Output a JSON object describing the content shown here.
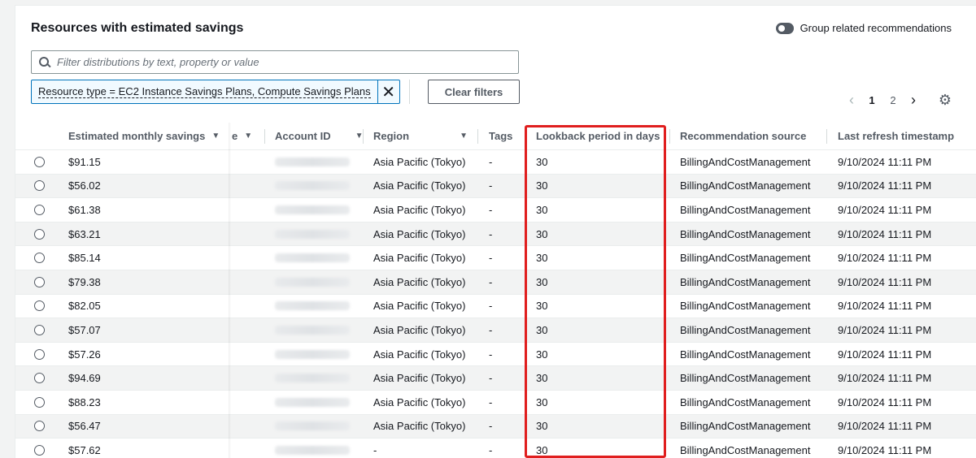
{
  "panel": {
    "title": "Resources with estimated savings",
    "group_toggle_label": "Group related recommendations"
  },
  "search": {
    "placeholder": "Filter distributions by text, property or value",
    "value": ""
  },
  "filter_token": {
    "text": "Resource type = EC2 Instance Savings Plans, Compute Savings Plans"
  },
  "clear_filters_label": "Clear filters",
  "pagination": {
    "prev": "‹",
    "pages": [
      "1",
      "2"
    ],
    "next": "›",
    "current": "1"
  },
  "icons": {
    "search": "search-icon",
    "close": "close-icon",
    "settings": "gear-icon",
    "sort": "caret-down-icon"
  },
  "colors": {
    "highlight": "#e01e1e",
    "link_blue": "#0073bb",
    "header_text": "#545b64"
  },
  "table": {
    "headers": {
      "savings": "Estimated monthly savings",
      "truncated": "e",
      "account": "Account ID",
      "region": "Region",
      "tags": "Tags",
      "lookback": "Lookback period in days",
      "source": "Recommendation source",
      "refresh": "Last refresh timestamp"
    },
    "rows": [
      {
        "savings": "$91.15",
        "region": "Asia Pacific (Tokyo)",
        "tags": "-",
        "lookback": "30",
        "source": "BillingAndCostManagement",
        "refresh": "9/10/2024 11:11 PM"
      },
      {
        "savings": "$56.02",
        "region": "Asia Pacific (Tokyo)",
        "tags": "-",
        "lookback": "30",
        "source": "BillingAndCostManagement",
        "refresh": "9/10/2024 11:11 PM"
      },
      {
        "savings": "$61.38",
        "region": "Asia Pacific (Tokyo)",
        "tags": "-",
        "lookback": "30",
        "source": "BillingAndCostManagement",
        "refresh": "9/10/2024 11:11 PM"
      },
      {
        "savings": "$63.21",
        "region": "Asia Pacific (Tokyo)",
        "tags": "-",
        "lookback": "30",
        "source": "BillingAndCostManagement",
        "refresh": "9/10/2024 11:11 PM"
      },
      {
        "savings": "$85.14",
        "region": "Asia Pacific (Tokyo)",
        "tags": "-",
        "lookback": "30",
        "source": "BillingAndCostManagement",
        "refresh": "9/10/2024 11:11 PM"
      },
      {
        "savings": "$79.38",
        "region": "Asia Pacific (Tokyo)",
        "tags": "-",
        "lookback": "30",
        "source": "BillingAndCostManagement",
        "refresh": "9/10/2024 11:11 PM"
      },
      {
        "savings": "$82.05",
        "region": "Asia Pacific (Tokyo)",
        "tags": "-",
        "lookback": "30",
        "source": "BillingAndCostManagement",
        "refresh": "9/10/2024 11:11 PM"
      },
      {
        "savings": "$57.07",
        "region": "Asia Pacific (Tokyo)",
        "tags": "-",
        "lookback": "30",
        "source": "BillingAndCostManagement",
        "refresh": "9/10/2024 11:11 PM"
      },
      {
        "savings": "$57.26",
        "region": "Asia Pacific (Tokyo)",
        "tags": "-",
        "lookback": "30",
        "source": "BillingAndCostManagement",
        "refresh": "9/10/2024 11:11 PM"
      },
      {
        "savings": "$94.69",
        "region": "Asia Pacific (Tokyo)",
        "tags": "-",
        "lookback": "30",
        "source": "BillingAndCostManagement",
        "refresh": "9/10/2024 11:11 PM"
      },
      {
        "savings": "$88.23",
        "region": "Asia Pacific (Tokyo)",
        "tags": "-",
        "lookback": "30",
        "source": "BillingAndCostManagement",
        "refresh": "9/10/2024 11:11 PM"
      },
      {
        "savings": "$56.47",
        "region": "Asia Pacific (Tokyo)",
        "tags": "-",
        "lookback": "30",
        "source": "BillingAndCostManagement",
        "refresh": "9/10/2024 11:11 PM"
      },
      {
        "savings": "$57.62",
        "region": "-",
        "tags": "-",
        "lookback": "30",
        "source": "BillingAndCostManagement",
        "refresh": "9/10/2024 11:11 PM"
      }
    ]
  }
}
